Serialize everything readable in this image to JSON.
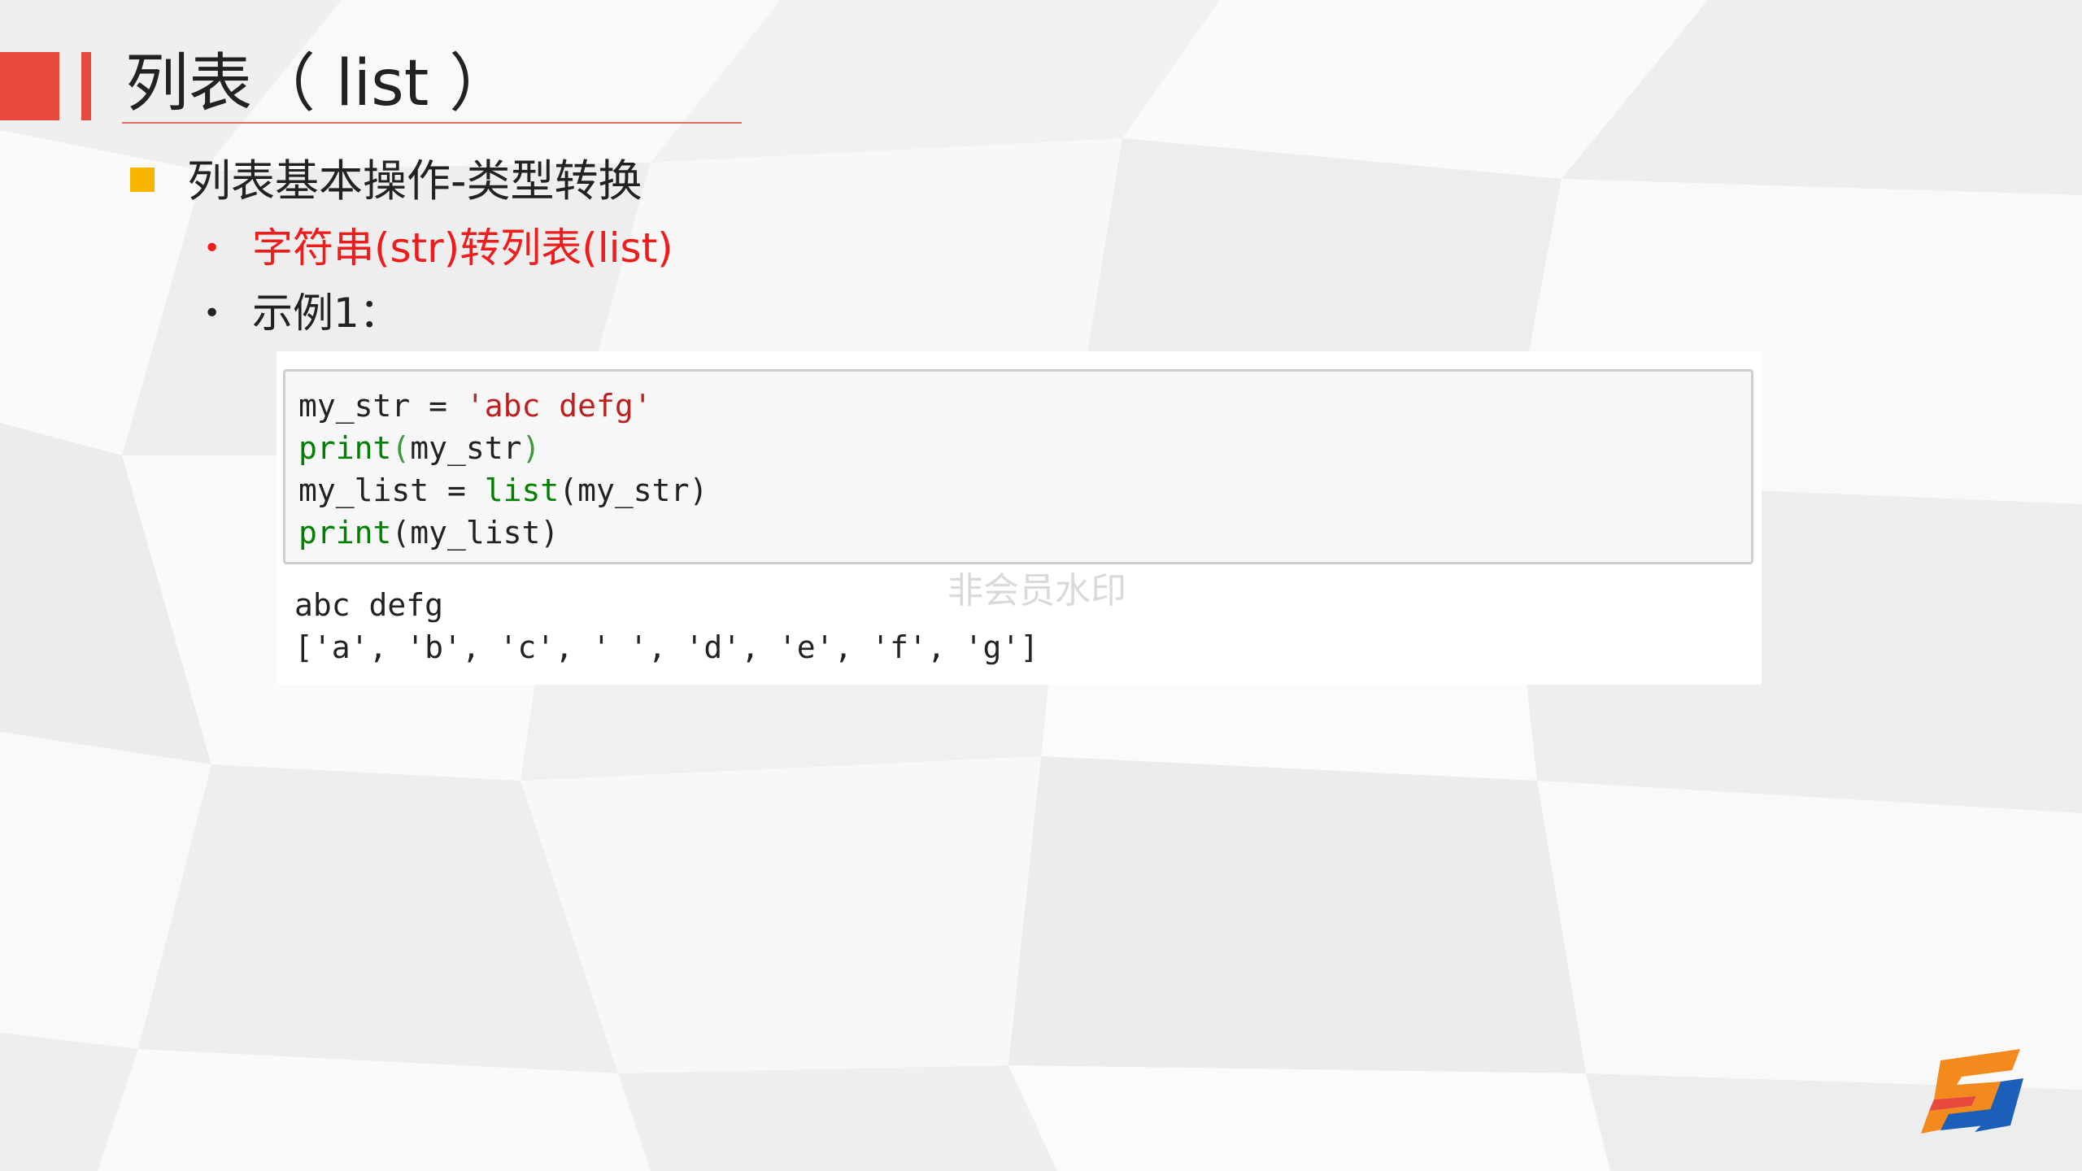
{
  "slide": {
    "title": "列表（ list ）",
    "bullet_l1": "列表基本操作-类型转换",
    "bullet_l2_highlight": "字符串(str)转列表(list)",
    "bullet_l2_example": "示例1："
  },
  "code": {
    "line1": {
      "var": "my_str = ",
      "str": "'abc defg'"
    },
    "line2": {
      "fn": "print",
      "open": "(",
      "arg": "my_str",
      "close": ")"
    },
    "line3": {
      "var": "my_list = ",
      "fn": "list",
      "args": "(my_str)"
    },
    "line4": {
      "fn": "print",
      "args": "(my_list)"
    }
  },
  "output": {
    "line1": "abc defg",
    "line2": "['a', 'b', 'c', ' ', 'd', 'e', 'f', 'g']"
  },
  "watermark": "非会员水印",
  "colors": {
    "accent_red": "#e8493d",
    "bullet_yellow": "#f7b500",
    "highlight_text": "#ee1c1c",
    "code_string": "#ba2121",
    "code_builtin": "#008000"
  },
  "icons": {
    "bullet_l1": "square-bullet-icon",
    "logo": "brand-logo-icon"
  }
}
